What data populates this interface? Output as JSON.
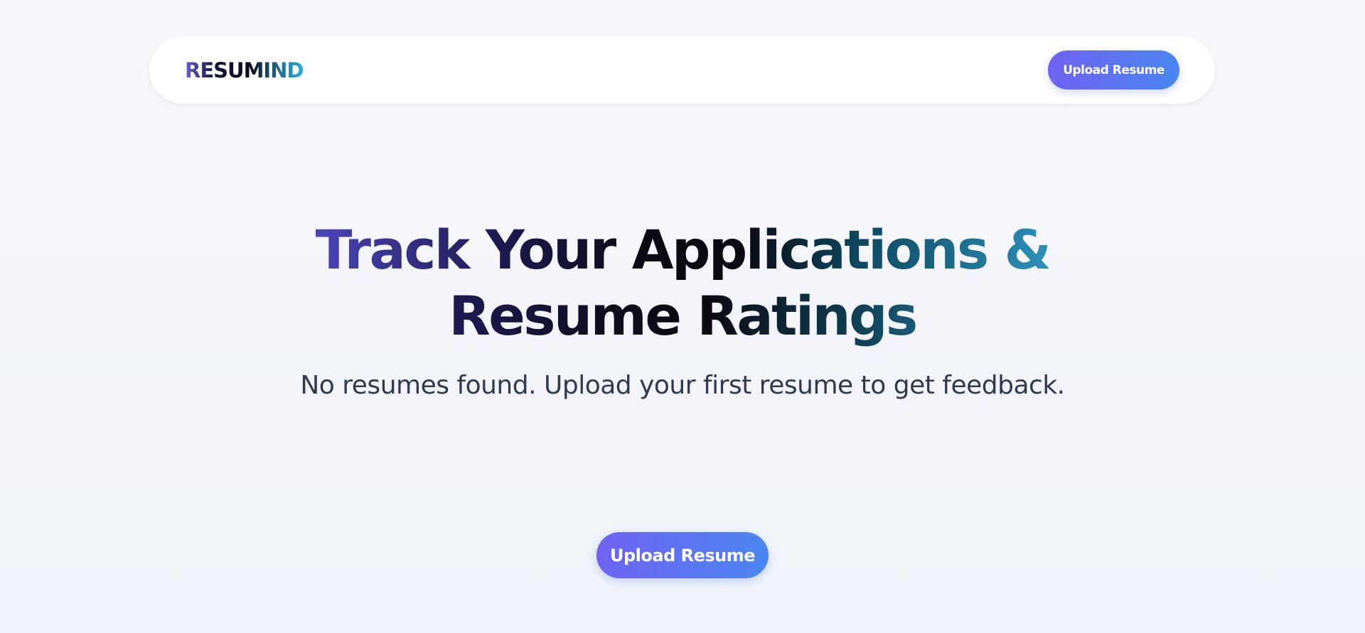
{
  "header": {
    "logo": "RESUMIND",
    "upload_button": "Upload Resume"
  },
  "hero": {
    "title_line1": "Track Your Applications &",
    "title_line2": "Resume Ratings",
    "subtitle": "No resumes found. Upload your first resume to get feedback.",
    "upload_button": "Upload Resume"
  },
  "colors": {
    "button_gradient_start": "#6f62f2",
    "button_gradient_end": "#4a86ef",
    "background": "#f4f6fa",
    "subtitle_text": "#2f3a4c"
  }
}
